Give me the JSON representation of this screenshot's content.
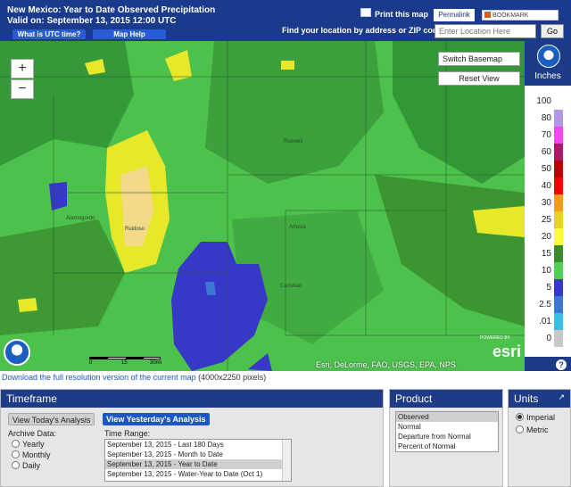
{
  "header": {
    "title": "New Mexico: Year to Date Observed Precipitation",
    "valid": "Valid on: September 13, 2015 12:00 UTC",
    "utc_button": "What is UTC time?",
    "help_button": "Map Help",
    "print_link": "Print this map",
    "permalink": "Permalink",
    "bookmark": "BOOKMARK",
    "find_label": "Find your location by address or ZIP code:",
    "location_placeholder": "Enter Location Here",
    "go_button": "Go"
  },
  "map": {
    "zoom_in": "+",
    "zoom_out": "−",
    "switch_basemap": "Switch Basemap",
    "reset_view": "Reset View",
    "towns": [
      "Roswell",
      "Alamogordo",
      "Artesia",
      "Carlsbad",
      "Ruidoso"
    ],
    "scale_labels": [
      "0",
      "15",
      "30mi"
    ],
    "attribution": "Esri, DeLorme, FAO, USGS, EPA, NPS",
    "esri_powered": "POWERED BY",
    "esri_logo": "esri"
  },
  "legend": {
    "units": "Inches",
    "values": [
      "100",
      "80",
      "70",
      "60",
      "50",
      "40",
      "30",
      "25",
      "20",
      "15",
      "10",
      "5",
      "2.5",
      ".01",
      "0"
    ],
    "colors": [
      "#ffffff",
      "#b496e6",
      "#f048f0",
      "#aa1a66",
      "#c00000",
      "#ff0000",
      "#f59a1a",
      "#e6d31a",
      "#ffff33",
      "#3a8a2c",
      "#50d050",
      "#3737c8",
      "#3c78d2",
      "#3cbce6",
      "#c8c8c8"
    ],
    "help_icon": "?"
  },
  "download": {
    "link_text": "Download the full resolution version of the current map",
    "dims": "(4000x2250 pixels)"
  },
  "timeframe": {
    "header": "Timeframe",
    "today_button": "View Today's Analysis",
    "yesterday_button": "View Yesterday's Analysis",
    "archive_label": "Archive Data:",
    "archive_options": [
      "Yearly",
      "Monthly",
      "Daily"
    ],
    "range_label": "Time Range:",
    "ranges": [
      "September 13, 2015 - Last 180 Days",
      "September 13, 2015 - Month to Date",
      "September 13, 2015 - Year to Date",
      "September 13, 2015 - Water-Year to Date (Oct 1)"
    ],
    "selected_range": "September 13, 2015 - Year to Date"
  },
  "product": {
    "header": "Product",
    "options": [
      "Observed",
      "Normal",
      "Departure from Normal",
      "Percent of Normal"
    ],
    "selected": "Observed"
  },
  "units": {
    "header": "Units",
    "header_icon": "↗",
    "options": [
      "Imperial",
      "Metric"
    ],
    "selected": "Imperial"
  }
}
